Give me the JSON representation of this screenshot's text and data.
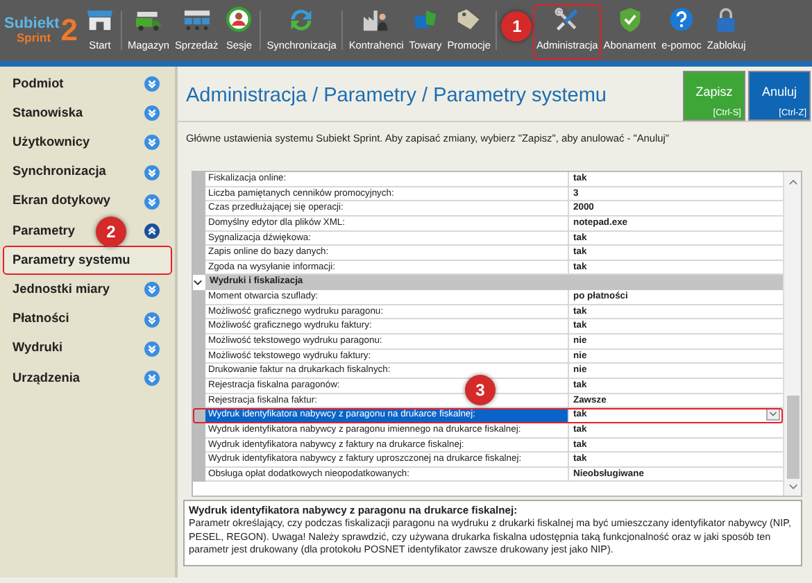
{
  "logo": {
    "name": "Subiekt",
    "edition": "Sprint",
    "version": "2"
  },
  "toolbar": [
    {
      "label": "Start",
      "highlighted": false
    },
    {
      "label": "Magazyn",
      "highlighted": false
    },
    {
      "label": "Sprzedaż",
      "highlighted": false
    },
    {
      "label": "Sesje",
      "highlighted": false
    },
    {
      "label": "Synchronizacja",
      "highlighted": false
    },
    {
      "label": "Kontrahenci",
      "highlighted": false
    },
    {
      "label": "Towary",
      "highlighted": false
    },
    {
      "label": "Promocje",
      "highlighted": false
    },
    {
      "label": "Administracja",
      "highlighted": true,
      "callout": "1"
    },
    {
      "label": "Abonament",
      "highlighted": false
    },
    {
      "label": "e-pomoc",
      "highlighted": false
    },
    {
      "label": "Zablokuj",
      "highlighted": false
    }
  ],
  "sidebar": [
    {
      "kind": "group",
      "label": "Podmiot",
      "expanded": false
    },
    {
      "kind": "group",
      "label": "Stanowiska",
      "expanded": false
    },
    {
      "kind": "group",
      "label": "Użytkownicy",
      "expanded": false
    },
    {
      "kind": "group",
      "label": "Synchronizacja",
      "expanded": false
    },
    {
      "kind": "group",
      "label": "Ekran dotykowy",
      "expanded": false
    },
    {
      "kind": "group",
      "label": "Parametry",
      "expanded": true,
      "callout": "2"
    },
    {
      "kind": "item",
      "label": "Parametry systemu",
      "selected": true,
      "highlighted": true
    },
    {
      "kind": "group",
      "label": "Jednostki miary",
      "expanded": false
    },
    {
      "kind": "group",
      "label": "Płatności",
      "expanded": false
    },
    {
      "kind": "group",
      "label": "Wydruki",
      "expanded": false
    },
    {
      "kind": "group",
      "label": "Urządzenia",
      "expanded": false
    }
  ],
  "header": {
    "title": "Administracja / Parametry / Parametry systemu"
  },
  "buttons": [
    {
      "kind": "save",
      "label": "Zapisz",
      "shortcut": "[Ctrl-S]"
    },
    {
      "kind": "cancel",
      "label": "Anuluj",
      "shortcut": "[Ctrl-Z]"
    }
  ],
  "description": "Główne ustawienia systemu Subiekt Sprint. Aby zapisać zmiany, wybierz \"Zapisz\", aby anulować - \"Anuluj\"",
  "grid": {
    "rows": [
      {
        "kind": "row",
        "label": "Fiskalizacja online:",
        "value": "tak",
        "selected": false
      },
      {
        "kind": "row",
        "label": "Liczba pamiętanych cenników promocyjnych:",
        "value": "3",
        "selected": false
      },
      {
        "kind": "row",
        "label": "Czas przedłużającej się operacji:",
        "value": "2000",
        "selected": false
      },
      {
        "kind": "row",
        "label": "Domyślny edytor dla plików XML:",
        "value": "notepad.exe",
        "selected": false
      },
      {
        "kind": "row",
        "label": "Sygnalizacja dźwiękowa:",
        "value": "tak",
        "selected": false
      },
      {
        "kind": "row",
        "label": "Zapis online do bazy danych:",
        "value": "tak",
        "selected": false
      },
      {
        "kind": "row",
        "label": "Zgoda na wysyłanie informacji:",
        "value": "tak",
        "selected": false
      },
      {
        "kind": "section",
        "label": "Wydruki i fiskalizacja",
        "expanded": true
      },
      {
        "kind": "row",
        "label": "Moment otwarcia szuflady:",
        "value": "po płatności",
        "selected": false
      },
      {
        "kind": "row",
        "label": "Możliwość graficznego wydruku paragonu:",
        "value": "tak",
        "selected": false
      },
      {
        "kind": "row",
        "label": "Możliwość graficznego wydruku faktury:",
        "value": "tak",
        "selected": false
      },
      {
        "kind": "row",
        "label": "Możliwość tekstowego wydruku paragonu:",
        "value": "nie",
        "selected": false
      },
      {
        "kind": "row",
        "label": "Możliwość tekstowego wydruku faktury:",
        "value": "nie",
        "selected": false
      },
      {
        "kind": "row",
        "label": "Drukowanie faktur na drukarkach fiskalnych:",
        "value": "nie",
        "selected": false
      },
      {
        "kind": "row",
        "label": "Rejestracja fiskalna paragonów:",
        "value": "tak",
        "selected": false
      },
      {
        "kind": "row",
        "label": "Rejestracja fiskalna faktur:",
        "value": "Zawsze",
        "selected": false
      },
      {
        "kind": "row",
        "label": "Wydruk identyfikatora nabywcy z paragonu na drukarce fiskalnej:",
        "value": "tak",
        "selected": true,
        "highlighted": true,
        "callout": "3"
      },
      {
        "kind": "row",
        "label": "Wydruk identyfikatora nabywcy z paragonu imiennego na drukarce fiskalnej:",
        "value": "tak",
        "selected": false
      },
      {
        "kind": "row",
        "label": "Wydruk identyfikatora nabywcy z faktury na drukarce fiskalnej:",
        "value": "tak",
        "selected": false
      },
      {
        "kind": "row",
        "label": "Wydruk identyfikatora nabywcy z faktury uproszczonej na drukarce fiskalnej:",
        "value": "tak",
        "selected": false
      },
      {
        "kind": "row",
        "label": "Obsługa opłat dodatkowych nieopodatkowanych:",
        "value": "Nieobsługiwane",
        "selected": false
      }
    ]
  },
  "help": {
    "title": "Wydruk identyfikatora nabywcy z paragonu na drukarce fiskalnej:",
    "text": "Parametr określający, czy podczas fiskalizacji paragonu na wydruku z drukarki fiskalnej ma być umieszczany identyfikator nabywcy (NIP, PESEL, REGON). Uwaga! Należy sprawdzić, czy używana drukarka fiskalna udostępnia taką funkcjonalność oraz w jaki sposób ten parametr jest drukowany (dla protokołu POSNET identyfikator zawsze drukowany jest jako NIP)."
  }
}
